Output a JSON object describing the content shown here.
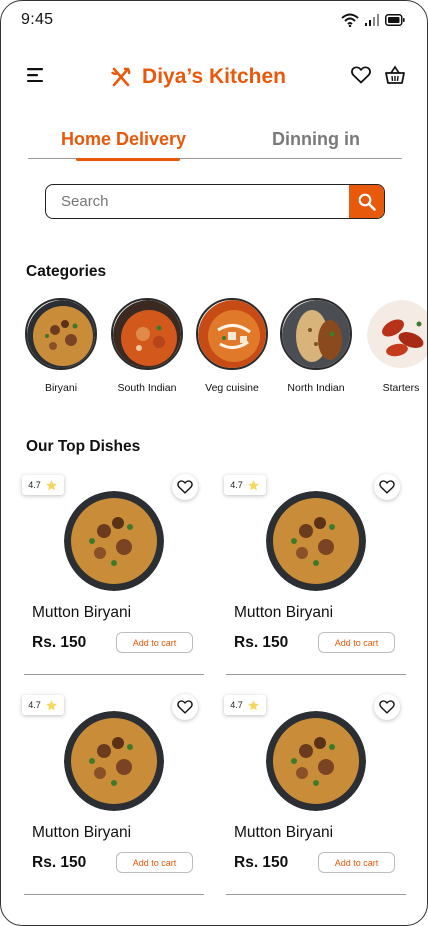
{
  "status_bar": {
    "time": "9:45"
  },
  "header": {
    "title": "Diya’s Kitchen"
  },
  "tabs": [
    {
      "label": "Home Delivery",
      "active": true
    },
    {
      "label": "Dinning in",
      "active": false
    }
  ],
  "search": {
    "placeholder": "Search"
  },
  "categories_section": {
    "title": "Categories",
    "items": [
      {
        "label": "Biryani"
      },
      {
        "label": "South Indian"
      },
      {
        "label": "Veg cuisine"
      },
      {
        "label": "North Indian"
      },
      {
        "label": "Starters"
      }
    ]
  },
  "top_dishes": {
    "title": "Our Top Dishes",
    "items": [
      {
        "name": "Mutton Biryani",
        "price": "Rs. 150",
        "rating": "4.7",
        "cart_label": "Add to cart"
      },
      {
        "name": "Mutton Biryani",
        "price": "Rs. 150",
        "rating": "4.7",
        "cart_label": "Add to cart"
      },
      {
        "name": "Mutton Biryani",
        "price": "Rs. 150",
        "rating": "4.7",
        "cart_label": "Add to cart"
      },
      {
        "name": "Mutton Biryani",
        "price": "Rs. 150",
        "rating": "4.7",
        "cart_label": "Add to cart"
      }
    ]
  },
  "icons": [
    "wifi-icon",
    "signal-icon",
    "battery-icon",
    "menu-icon",
    "fork-knife-icon",
    "heart-icon",
    "basket-icon",
    "search-icon",
    "star-icon"
  ],
  "colors": {
    "accent": "#e8590c",
    "text": "#111111",
    "muted": "#7a7a7a"
  }
}
